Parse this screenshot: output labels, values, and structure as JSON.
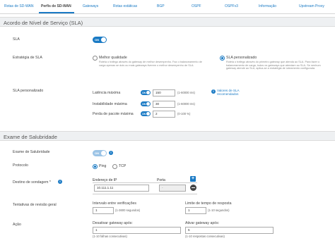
{
  "tabs": [
    {
      "label": "Rotas de SD-WAN"
    },
    {
      "label": "Perfis de SD-WAN"
    },
    {
      "label": "Gateways"
    },
    {
      "label": "Rotas estáticas"
    },
    {
      "label": "BGP"
    },
    {
      "label": "OSPF"
    },
    {
      "label": "OSPFv3"
    },
    {
      "label": "Informação"
    },
    {
      "label": "Upstream Proxy"
    }
  ],
  "sla": {
    "title": "Acordo de Nível de Serviço (SLA)",
    "sla_label": "SLA",
    "sla_toggle": "ON",
    "strategy_label": "Estratégia de SLA",
    "best_quality_label": "Melhor qualidade",
    "best_quality_desc": "Roteia o tráfego através do gateway de melhor desempenho. Faz o balanceamento de carga apenas se dois ou mais gateways tiverem o melhor desempenho de SLA.",
    "custom_label": "SLA personalizado",
    "custom_desc": "Roteia o tráfego através do primeiro gateway que atenda ao SLA. Para fazer o balanceamento de carga, todos os gateways que atendam ao SLA. Se nenhum gateway atende ao SLA, aplica-se a estratégia de roteamento configurada.",
    "custom_sla_label": "SLA personalizado",
    "latency_label": "Latência máxima",
    "latency_toggle": "ON",
    "latency_value": "150",
    "latency_range": "(1-60000 ms)",
    "jitter_label": "Instabilidade máxima",
    "jitter_toggle": "ON",
    "jitter_value": "30",
    "jitter_range": "(1-60000 ms)",
    "loss_label": "Perda de pacote máxima",
    "loss_toggle": "ON",
    "loss_value": "2",
    "loss_range": "(0-100 %)",
    "recommended_link": "Valores de SLA recomendados"
  },
  "health": {
    "title": "Exame de Salubridade",
    "check_label": "Exame de Salubridade",
    "check_toggle": "ON",
    "protocol_label": "Protocolo",
    "ping_label": "Ping",
    "tcp_label": "TCP",
    "dest_label": "Destino de sondagem *",
    "ip_header": "Endereço de IP",
    "port_header": "Porta",
    "ip_value": "10.111.1.11",
    "port_value": "-",
    "retry_label": "Tentativas de revisão geral",
    "interval_label": "Intervalo entre verificações",
    "interval_value": "1",
    "interval_range": "(1-3600 segundos)",
    "timeout_label": "Limite de tempo de resposta",
    "timeout_value": "1",
    "timeout_range": "(1-10 segundos)",
    "action_label": "Ação",
    "deactivate_label": "Desativar gateway após:",
    "deactivate_value": "1",
    "deactivate_range": "(1-10 falhas consecutivas)",
    "activate_label": "Ativar gateway após:",
    "activate_value": "5",
    "activate_range": "(1-10 respostas consecutivas)"
  },
  "colors": {
    "accent": "#1a7ac4",
    "section_bg": "#eef0f2"
  }
}
